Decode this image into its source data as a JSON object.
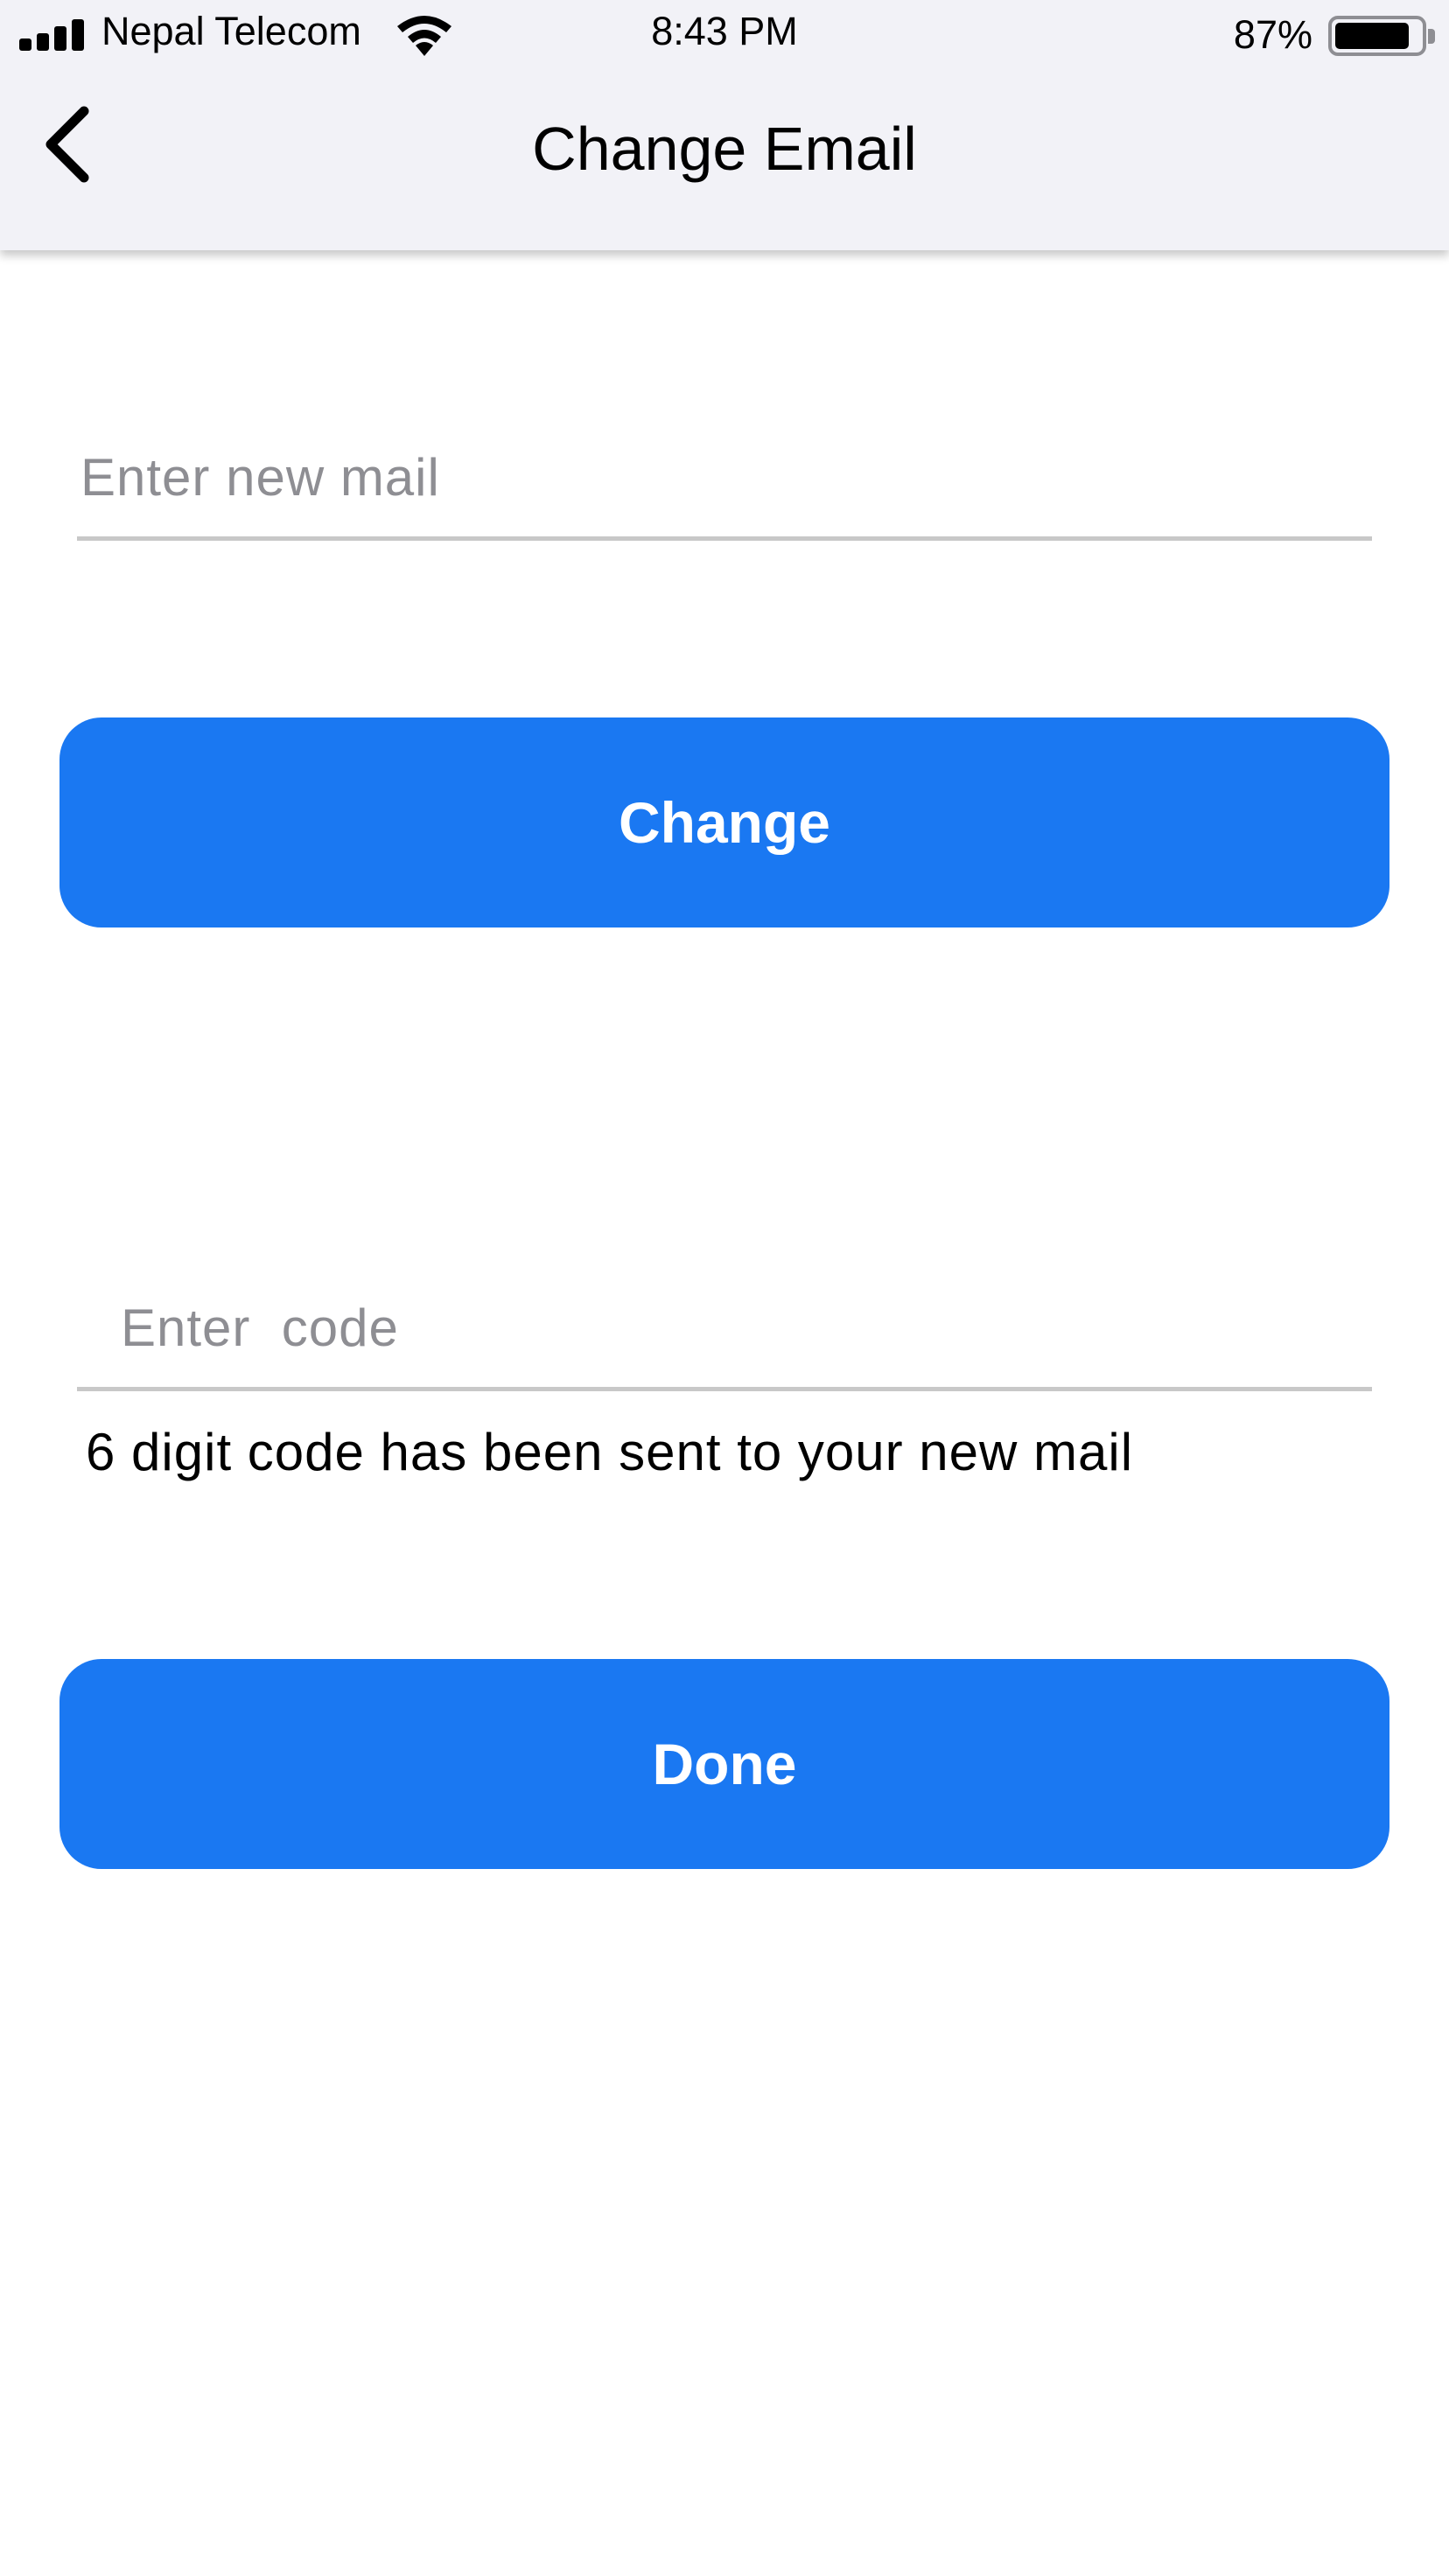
{
  "status_bar": {
    "carrier": "Nepal Telecom",
    "time": "8:43 PM",
    "battery_percent": "87%",
    "battery_level": 0.87,
    "signal_icon": "cellular-signal-icon",
    "wifi_icon": "wifi-icon",
    "battery_icon": "battery-icon"
  },
  "nav": {
    "title": "Change Email",
    "back_icon": "chevron-left-icon"
  },
  "form": {
    "email_placeholder": "Enter new mail",
    "email_value": "",
    "change_label": "Change",
    "code_placeholder": "Enter  code",
    "code_value": "",
    "hint": "6 digit code has been sent to your new mail",
    "done_label": "Done"
  },
  "colors": {
    "primary": "#1a78f2",
    "nav_background": "#f2f2f7",
    "divider": "#c8c8c8",
    "placeholder": "#8e8e93"
  }
}
